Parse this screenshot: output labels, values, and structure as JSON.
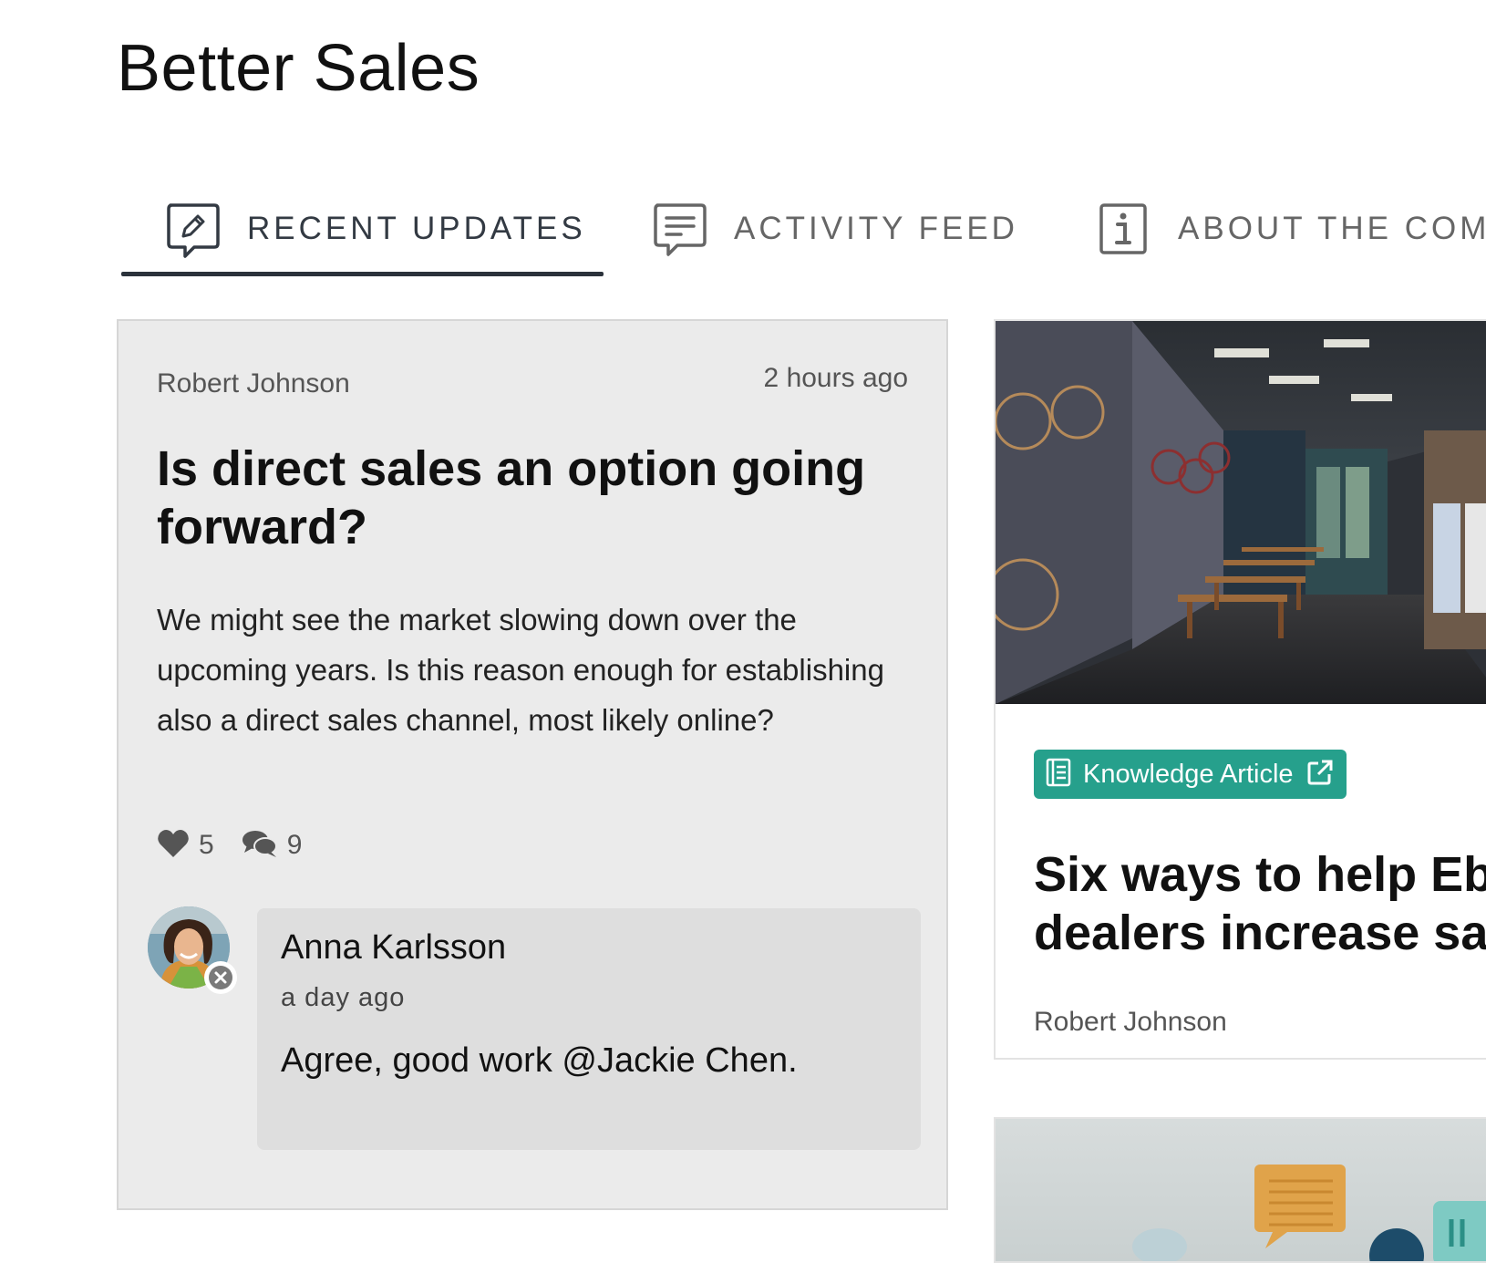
{
  "page": {
    "title": "Better Sales"
  },
  "tabs": [
    {
      "label": "RECENT UPDATES",
      "icon": "edit-comment-icon",
      "active": true
    },
    {
      "label": "ACTIVITY FEED",
      "icon": "comment-lines-icon",
      "active": false
    },
    {
      "label": "ABOUT THE COMM",
      "icon": "info-icon",
      "active": false
    }
  ],
  "post": {
    "author": "Robert Johnson",
    "time": "2 hours ago",
    "title": "Is direct sales an option going forward?",
    "body": "We might see the market slowing down over the upcoming years. Is this reason enough for establishing also a direct sales channel, most likely online?",
    "likes": "5",
    "comments": "9",
    "comment": {
      "author": "Anna Karlsson",
      "time": "a day ago",
      "text": "Agree, good work @Jackie Chen."
    }
  },
  "article": {
    "badge": "Knowledge Article",
    "title_line1": "Six ways to help Ebi",
    "title_line2": "dealers increase sa",
    "author": "Robert Johnson"
  },
  "colors": {
    "accent": "#26a08c",
    "tab_underline": "#2b323b",
    "card_bg": "#ebebeb",
    "comment_bg": "#dedede"
  }
}
